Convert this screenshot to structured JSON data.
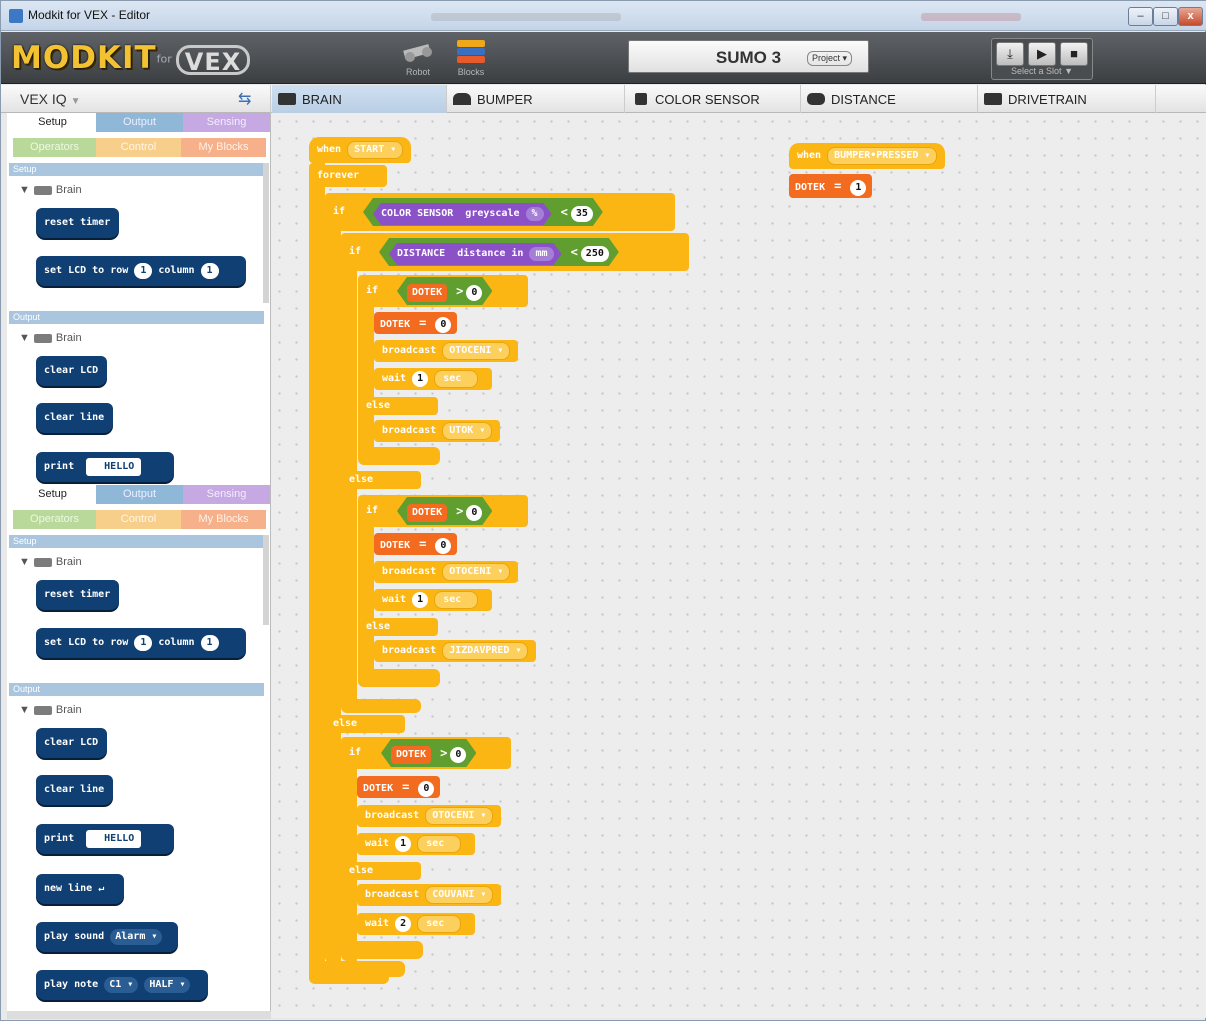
{
  "window": {
    "title": "Modkit for VEX - Editor",
    "min": "–",
    "max": "□",
    "close": "x"
  },
  "toolbar": {
    "logo": "MODKIT",
    "logo_for": "for",
    "logo_vex": "VEX",
    "robot_label": "Robot",
    "blocks_label": "Blocks",
    "project_name": "SUMO 3",
    "project_menu": "Project ▾",
    "slot_label": "Select a Slot",
    "slot_arrow": "▼",
    "download_icon": "⤓",
    "play_icon": "▶",
    "stop_icon": "■"
  },
  "platform": {
    "label": "VEX IQ",
    "arrow": "▼",
    "swap_icon": "⇆"
  },
  "device_tabs": [
    {
      "label": "BRAIN",
      "icon": "brain-icon"
    },
    {
      "label": "BUMPER",
      "icon": "bumper-icon"
    },
    {
      "label": "COLOR SENSOR",
      "icon": "color-sensor-icon"
    },
    {
      "label": "DISTANCE",
      "icon": "distance-icon"
    },
    {
      "label": "DRIVETRAIN",
      "icon": "drivetrain-icon"
    }
  ],
  "palette": {
    "tabs": [
      "Setup",
      "Output",
      "Sensing",
      "Operators",
      "Control",
      "My Blocks"
    ],
    "sections": {
      "setup": "Setup",
      "output": "Output"
    },
    "brain": "Brain",
    "blocks": {
      "reset_timer": "reset timer",
      "set_lcd": "set LCD to row",
      "column": "column",
      "row_val": "1",
      "col_val": "1",
      "clear_lcd": "clear LCD",
      "clear_line": "clear line",
      "print": "print",
      "hello": "HELLO",
      "new_line": "new line ↵",
      "play_sound": "play sound",
      "alarm": "Alarm ▾",
      "play_note": "play note",
      "c1": "C1 ▾",
      "half": "HALF ▾"
    }
  },
  "script": {
    "when": "when",
    "start": "START ▾",
    "forever": "forever",
    "if": "if",
    "else": "else",
    "color_sensor": "COLOR SENSOR",
    "greyscale": "greyscale",
    "pct": "% ",
    "lt": "<",
    "gt": ">",
    "eq": "=",
    "v35": "35",
    "distance": "DISTANCE",
    "distance_in": "distance in",
    "mm": "mm",
    "v250": "250",
    "dotek": "DOTEK",
    "v0": "0",
    "v1": "1",
    "v2": "2",
    "broadcast": "broadcast",
    "otoceni": "OTOCENI ▾",
    "utok": "UTOK ▾",
    "jizdavpred": "JIZDAVPRED ▾",
    "couvani": "COUVANI ▾",
    "wait": "wait",
    "sec": "sec",
    "bumper_pressed": "BUMPER•PRESSED ▾"
  },
  "colors": {
    "control": "#fbb614",
    "variable": "#f26b1f",
    "operator": "#5f9e2f",
    "sensor": "#8b52c7",
    "brain_block": "#0f3f73"
  }
}
